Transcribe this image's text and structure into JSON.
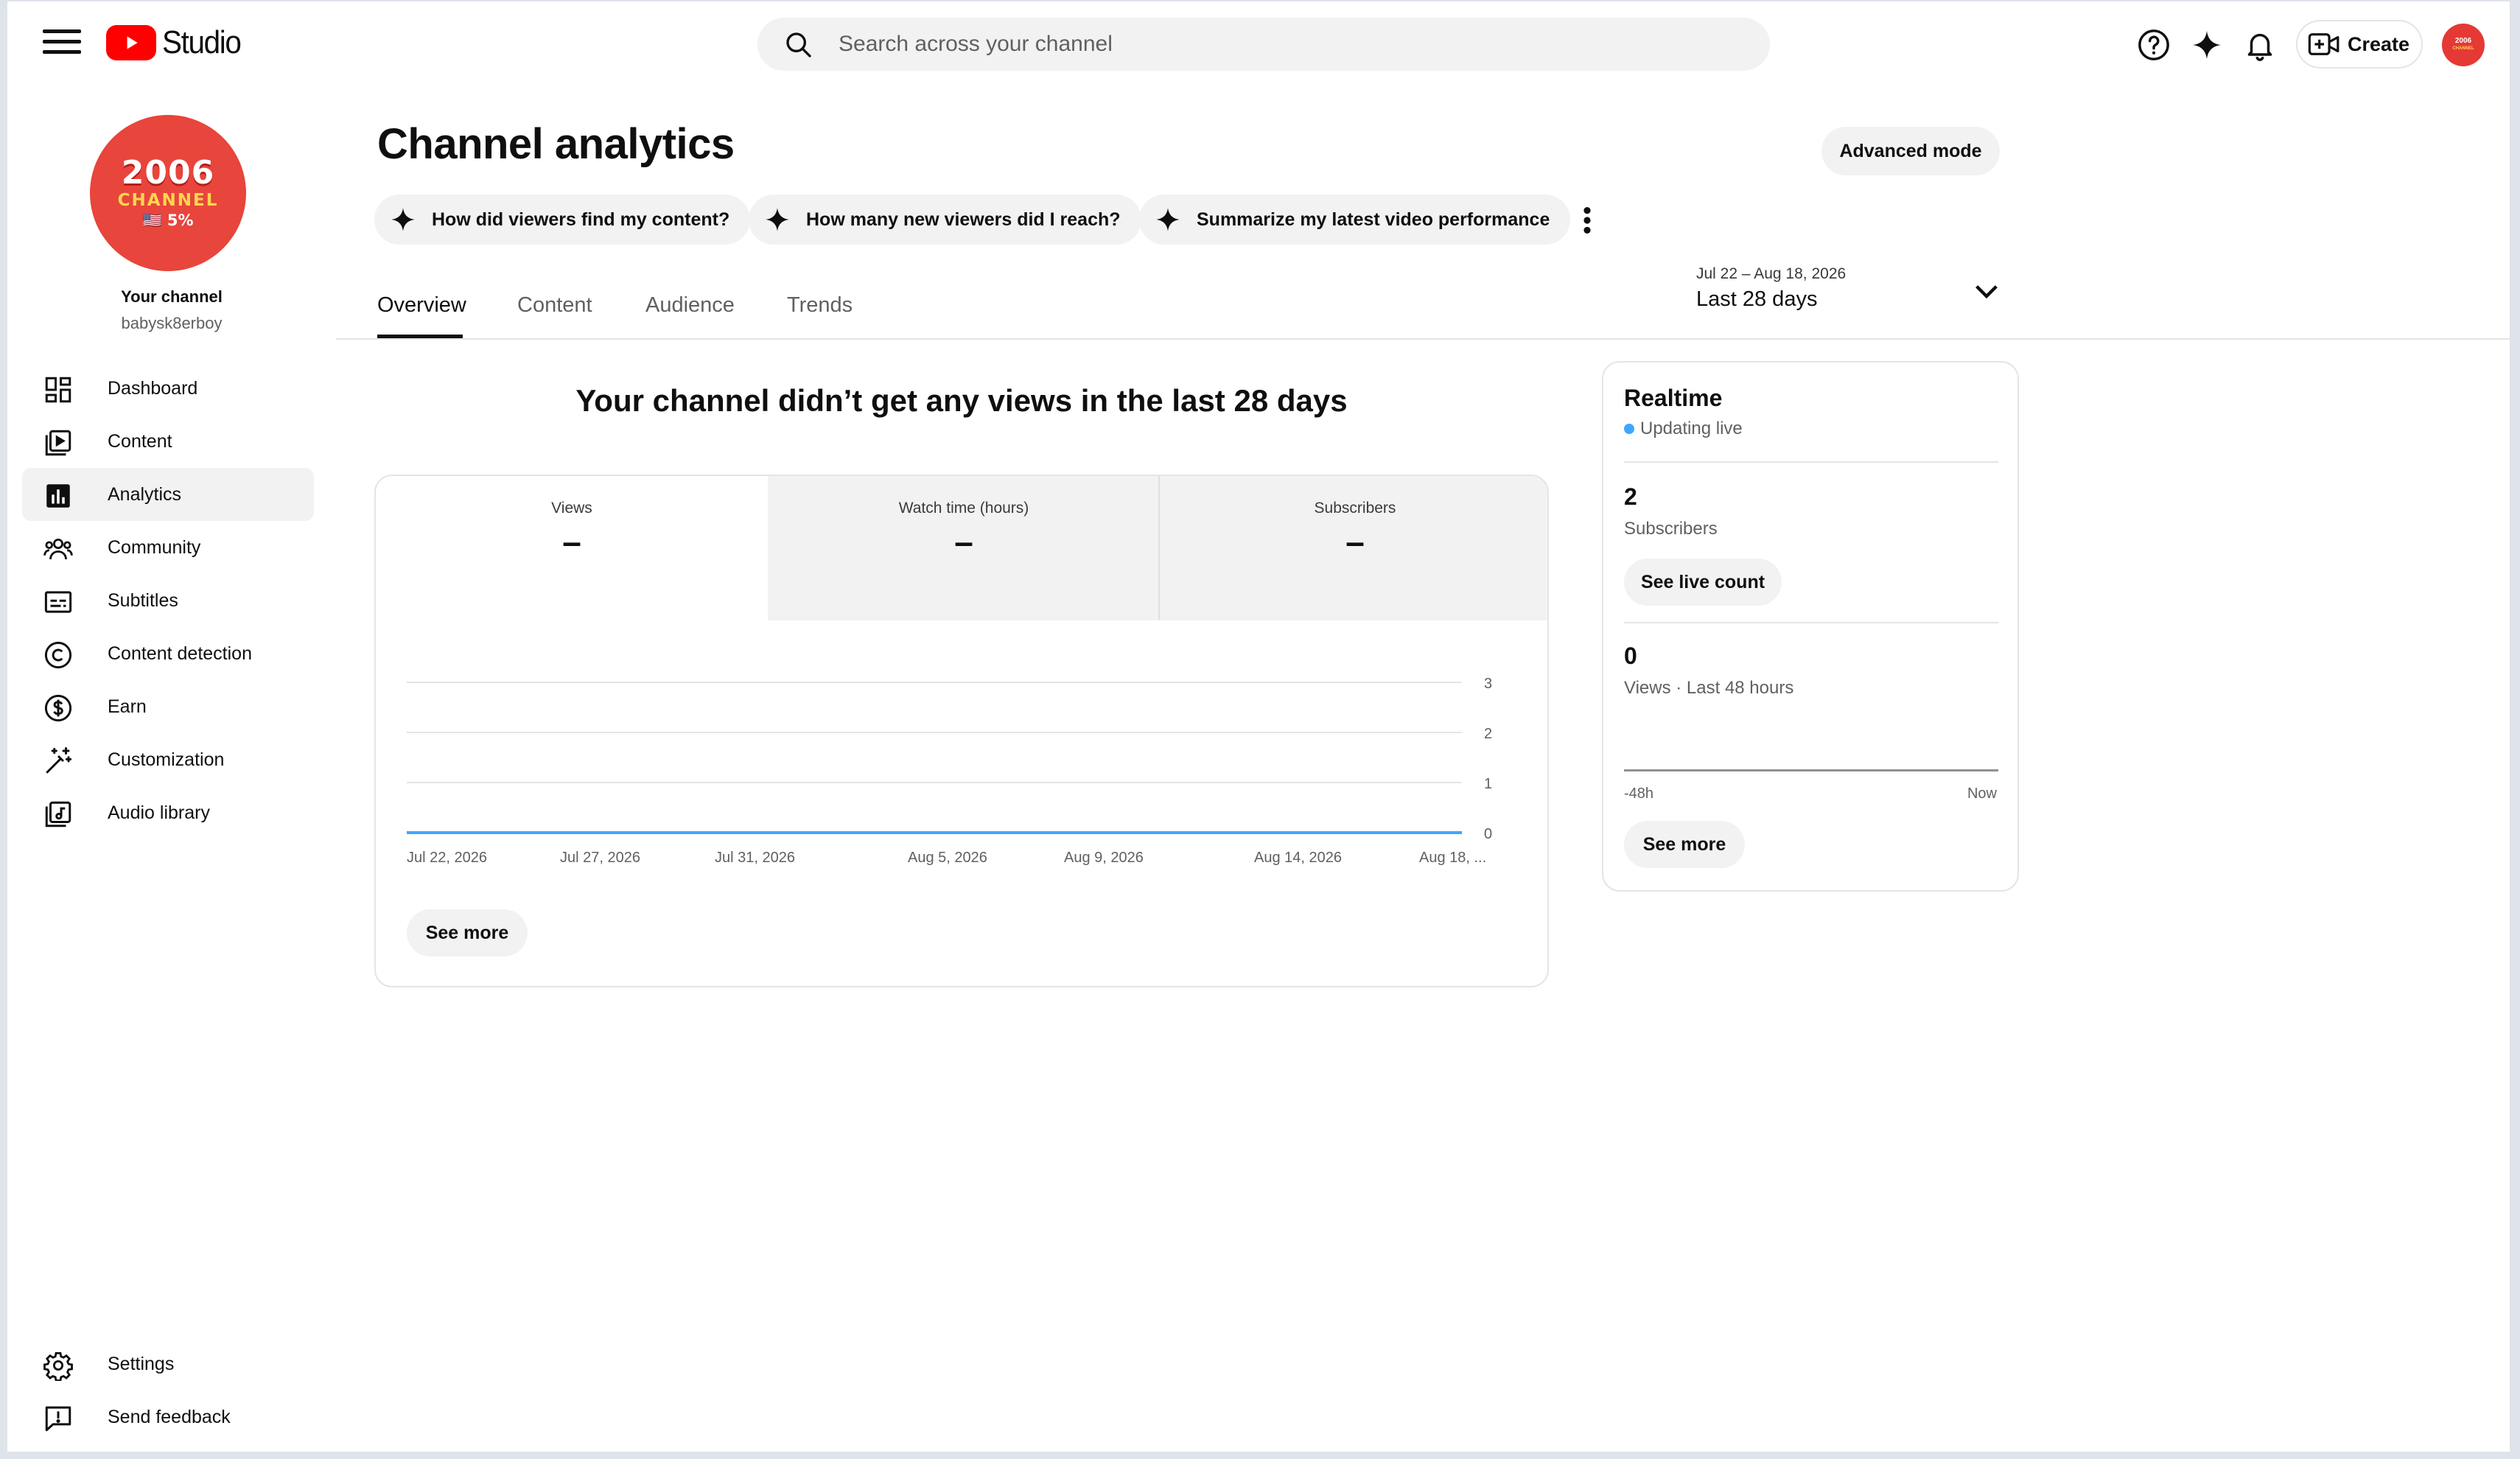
{
  "header": {
    "app_name": "Studio",
    "search_placeholder": "Search across your channel",
    "create_label": "Create"
  },
  "avatar": {
    "line1": "2006",
    "line2": "CHANNEL",
    "line3": "🇺🇸 5%"
  },
  "sidebar": {
    "channel_label": "Your channel",
    "channel_handle": "babysk8erboy",
    "items": [
      {
        "label": "Dashboard",
        "icon": "dashboard-icon"
      },
      {
        "label": "Content",
        "icon": "content-icon"
      },
      {
        "label": "Analytics",
        "icon": "analytics-icon",
        "active": true
      },
      {
        "label": "Community",
        "icon": "community-icon"
      },
      {
        "label": "Subtitles",
        "icon": "subtitles-icon"
      },
      {
        "label": "Content detection",
        "icon": "copyright-icon"
      },
      {
        "label": "Earn",
        "icon": "dollar-icon"
      },
      {
        "label": "Customization",
        "icon": "magic-wand-icon"
      },
      {
        "label": "Audio library",
        "icon": "audio-library-icon"
      }
    ],
    "bottom": [
      {
        "label": "Settings",
        "icon": "gear-icon"
      },
      {
        "label": "Send feedback",
        "icon": "feedback-icon"
      }
    ]
  },
  "main": {
    "title": "Channel analytics",
    "advanced_mode": "Advanced mode",
    "chips": [
      "How did viewers find my content?",
      "How many new viewers did I reach?",
      "Summarize my latest video performance"
    ],
    "tabs": [
      "Overview",
      "Content",
      "Audience",
      "Trends"
    ],
    "active_tab": "Overview",
    "date_range": "Jul 22 – Aug 18, 2026",
    "date_label": "Last 28 days",
    "headline": "Your channel didn’t get any views in the last 28 days",
    "metrics": [
      {
        "label": "Views",
        "value": "–"
      },
      {
        "label": "Watch time (hours)",
        "value": "–"
      },
      {
        "label": "Subscribers",
        "value": "–"
      }
    ],
    "see_more": "See more"
  },
  "chart_data": {
    "type": "line",
    "x": [
      "Jul 22, 2026",
      "Jul 27, 2026",
      "Jul 31, 2026",
      "Aug 5, 2026",
      "Aug 9, 2026",
      "Aug 14, 2026",
      "Aug 18, ..."
    ],
    "series": [
      {
        "values": [
          0,
          0,
          0,
          0,
          0,
          0,
          0
        ]
      }
    ],
    "y_ticks": [
      0,
      1,
      2,
      3
    ],
    "ylim": [
      0,
      3
    ],
    "grid": true,
    "line_color": "#3ea6ff"
  },
  "realtime": {
    "title": "Realtime",
    "status": "Updating live",
    "subscribers_value": "2",
    "subscribers_label": "Subscribers",
    "live_count_button": "See live count",
    "views_value": "0",
    "views_label": "Views · Last 48 hours",
    "axis_start": "-48h",
    "axis_end": "Now",
    "see_more": "See more"
  }
}
